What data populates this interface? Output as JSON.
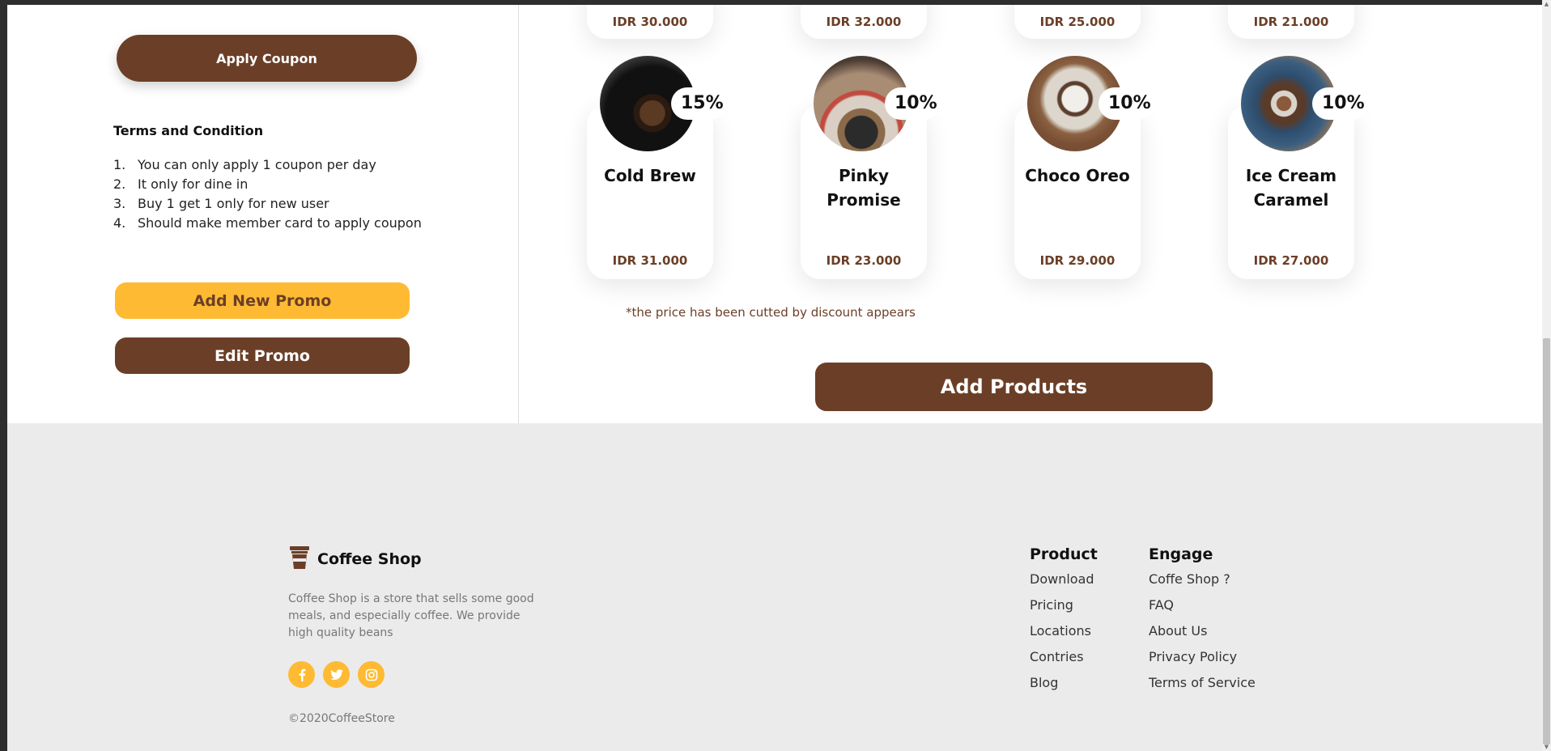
{
  "coupon": {
    "apply_label": "Apply Coupon",
    "terms_title": "Terms and Condition",
    "terms": [
      {
        "num": "1.",
        "text": "You can only apply 1 coupon per day"
      },
      {
        "num": "2.",
        "text": "It only for dine in"
      },
      {
        "num": "3.",
        "text": "Buy 1 get 1 only for new user"
      },
      {
        "num": "4.",
        "text": "Should make member card to apply coupon"
      }
    ],
    "add_promo_label": "Add New Promo",
    "edit_promo_label": "Edit Promo"
  },
  "top_prices": [
    "IDR 30.000",
    "IDR 32.000",
    "IDR 25.000",
    "IDR 21.000"
  ],
  "products": [
    {
      "name": "Cold Brew",
      "price": "IDR 31.000",
      "discount": "15%"
    },
    {
      "name": "Pinky Promise",
      "price": "IDR 23.000",
      "discount": "10%"
    },
    {
      "name": "Choco Oreo",
      "price": "IDR 29.000",
      "discount": "10%"
    },
    {
      "name": "Ice Cream Caramel",
      "price": "IDR 27.000",
      "discount": "10%"
    }
  ],
  "note": "*the price has been cutted by discount appears",
  "add_products_label": "Add Products",
  "footer": {
    "brand": "Coffee Shop",
    "description": "Coffee Shop is a store that sells some good meals, and especially coffee. We provide high quality beans",
    "copyright": "©2020CoffeeStore",
    "socials": [
      "facebook-icon",
      "twitter-icon",
      "instagram-icon"
    ],
    "product_title": "Product",
    "product_links": [
      "Download",
      "Pricing",
      "Locations",
      "Contries",
      "Blog"
    ],
    "engage_title": "Engage",
    "engage_links": [
      "Coffe Shop ?",
      "FAQ",
      "About Us",
      "Privacy Policy",
      "Terms of Service"
    ]
  },
  "colors": {
    "brown": "#6b3f27",
    "yellow": "#ffba33",
    "footer_bg": "#ebebeb"
  }
}
